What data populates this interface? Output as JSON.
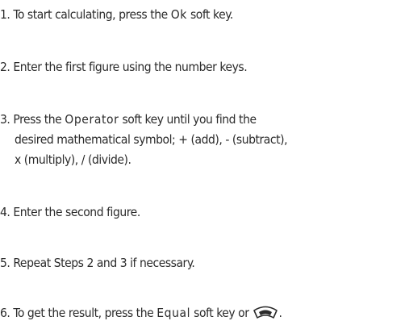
{
  "steps": [
    {
      "number": "1.",
      "before": "To start calculating, press the",
      "softkey": "Ok",
      "after": "soft key."
    },
    {
      "number": "2.",
      "text": "Enter the first figure using the number keys."
    },
    {
      "number": "3.",
      "before": "Press the",
      "softkey": "Operator",
      "after": "soft key  until you find the",
      "line2": "desired mathematical symbol;  + (add), - (subtract),",
      "line3": "x (multiply),  / (divide)."
    },
    {
      "number": "4.",
      "text": "Enter the second figure."
    },
    {
      "number": "5.",
      "text": "Repeat Steps 2 and 3 if necessary."
    },
    {
      "number": "6.",
      "before": "To get the result, press the",
      "softkey": "Equal",
      "after": "soft key or",
      "end": "."
    }
  ],
  "icons": {
    "send_key": "send-key-icon"
  },
  "colors": {
    "text": "#2b2b2b"
  }
}
